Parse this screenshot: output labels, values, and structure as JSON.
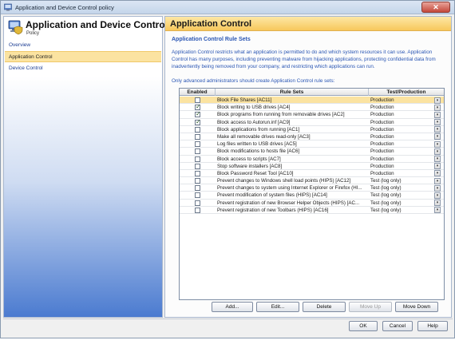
{
  "window": {
    "title": "Application and Device Control policy",
    "close_label": "✕"
  },
  "sidebar": {
    "title": "Application and Device Control",
    "subtitle": "Policy",
    "items": [
      {
        "label": "Overview",
        "active": false
      },
      {
        "label": "Application Control",
        "active": true
      },
      {
        "label": "Device Control",
        "active": false
      }
    ]
  },
  "main": {
    "header": "Application Control",
    "section_title": "Application Control Rule Sets",
    "description": "Application Control restricts what an application is permitted to do and which system resources it can use. Application Control has many purposes, including preventing malware from hijacking applications, protecting confidential data from inadvertently being removed from your company, and restricting which applications can run.",
    "note": "Only advanced administrators should create Application Control rule sets:",
    "columns": {
      "enabled": "Enabled",
      "rule": "Rule Sets",
      "mode": "Test/Production"
    },
    "rules": [
      {
        "enabled": false,
        "name": "Block File Shares [AC11]",
        "mode": "Production",
        "selected": true
      },
      {
        "enabled": true,
        "name": "Block writing to USB drives [AC4]",
        "mode": "Production",
        "selected": false
      },
      {
        "enabled": true,
        "name": "Block programs from running from removable drives [AC2]",
        "mode": "Production",
        "selected": false
      },
      {
        "enabled": true,
        "name": "Block access to Autorun.inf [AC9]",
        "mode": "Production",
        "selected": false
      },
      {
        "enabled": false,
        "name": "Block applications from running [AC1]",
        "mode": "Production",
        "selected": false
      },
      {
        "enabled": false,
        "name": "Make all removable drives read-only [AC3]",
        "mode": "Production",
        "selected": false
      },
      {
        "enabled": false,
        "name": "Log files written to USB drives [AC5]",
        "mode": "Production",
        "selected": false
      },
      {
        "enabled": false,
        "name": "Block modifications to hosts file [AC6]",
        "mode": "Production",
        "selected": false
      },
      {
        "enabled": false,
        "name": "Block access to scripts [AC7]",
        "mode": "Production",
        "selected": false
      },
      {
        "enabled": false,
        "name": "Stop software installers [AC8]",
        "mode": "Production",
        "selected": false
      },
      {
        "enabled": false,
        "name": "Block Password Reset Tool [AC10]",
        "mode": "Production",
        "selected": false
      },
      {
        "enabled": false,
        "name": "Prevent changes to Windows shell load points (HIPS) [AC12]",
        "mode": "Test (log only)",
        "selected": false
      },
      {
        "enabled": false,
        "name": "Prevent changes to system using Internet Explorer or Firefox (HI...",
        "mode": "Test (log only)",
        "selected": false
      },
      {
        "enabled": false,
        "name": "Prevent modification of system files (HIPS) [AC14]",
        "mode": "Test (log only)",
        "selected": false
      },
      {
        "enabled": false,
        "name": "Prevent registration of new Browser Helper Objects (HIPS) [AC...",
        "mode": "Test (log only)",
        "selected": false
      },
      {
        "enabled": false,
        "name": "Prevent registration of new Toolbars (HIPS) [AC16]",
        "mode": "Test (log only)",
        "selected": false
      }
    ],
    "buttons": {
      "add": "Add...",
      "edit": "Edit...",
      "delete": "Delete",
      "move_up": "Move Up",
      "move_down": "Move Down"
    }
  },
  "footer": {
    "ok": "OK",
    "cancel": "Cancel",
    "help": "Help"
  },
  "icons": {
    "app": "policy-icon",
    "header": "computer-shield-icon",
    "check": "✓",
    "dropdown": "▾"
  }
}
